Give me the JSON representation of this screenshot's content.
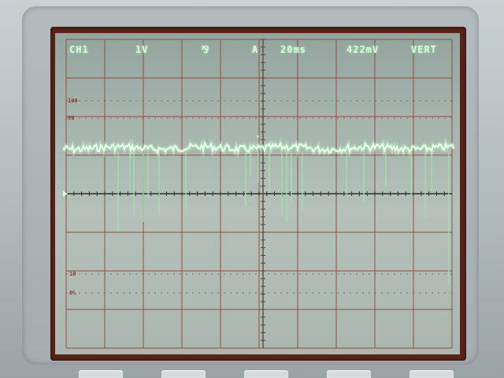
{
  "readouts": {
    "channel": "CH1",
    "volts_per_div": "1V",
    "trigger_symbol": "⅋",
    "trigger_mode": "A",
    "time_per_div": "20ms",
    "trigger_level": "422mV",
    "display_mode": "VERT"
  },
  "scale_labels": {
    "p100": "100",
    "p90": "90",
    "p10": "10",
    "p0": "0%"
  },
  "colors": {
    "trace": "#e8ffe8",
    "phosphor": "#d9f7dc",
    "graticule": "#8a4a3a",
    "frame": "#5a2418"
  }
}
